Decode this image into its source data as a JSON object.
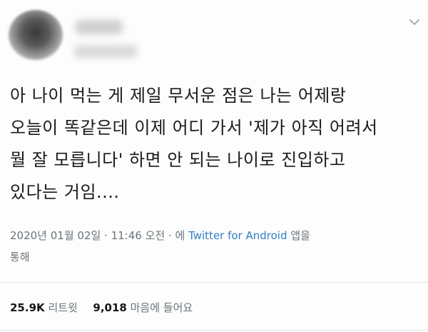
{
  "tweet": {
    "lines": [
      "아 나이 먹는 게 제일 무서운 점은 나는 어제랑",
      "오늘이 똑같은데 이제 어디 가서 '제가 아직 어려서",
      "뭘 잘 모릅니다' 하면 안 되는 나이로 진입하고",
      "있다는 거임...."
    ]
  },
  "meta": {
    "line1_prefix": "2020년 01월 02일 · 11:46 오전 · 에 ",
    "client": "Twitter for Android",
    "line1_suffix": " 앱을",
    "line2": "통해"
  },
  "stats": {
    "retweets_count": "25.9K",
    "retweets_label": "리트윗",
    "likes_count": "9,018",
    "likes_label": "마음에 들어요"
  },
  "icons": {
    "chevron": "chevron-down-icon"
  },
  "colors": {
    "link": "#2f7fc4",
    "meta_text": "#6b7378"
  }
}
